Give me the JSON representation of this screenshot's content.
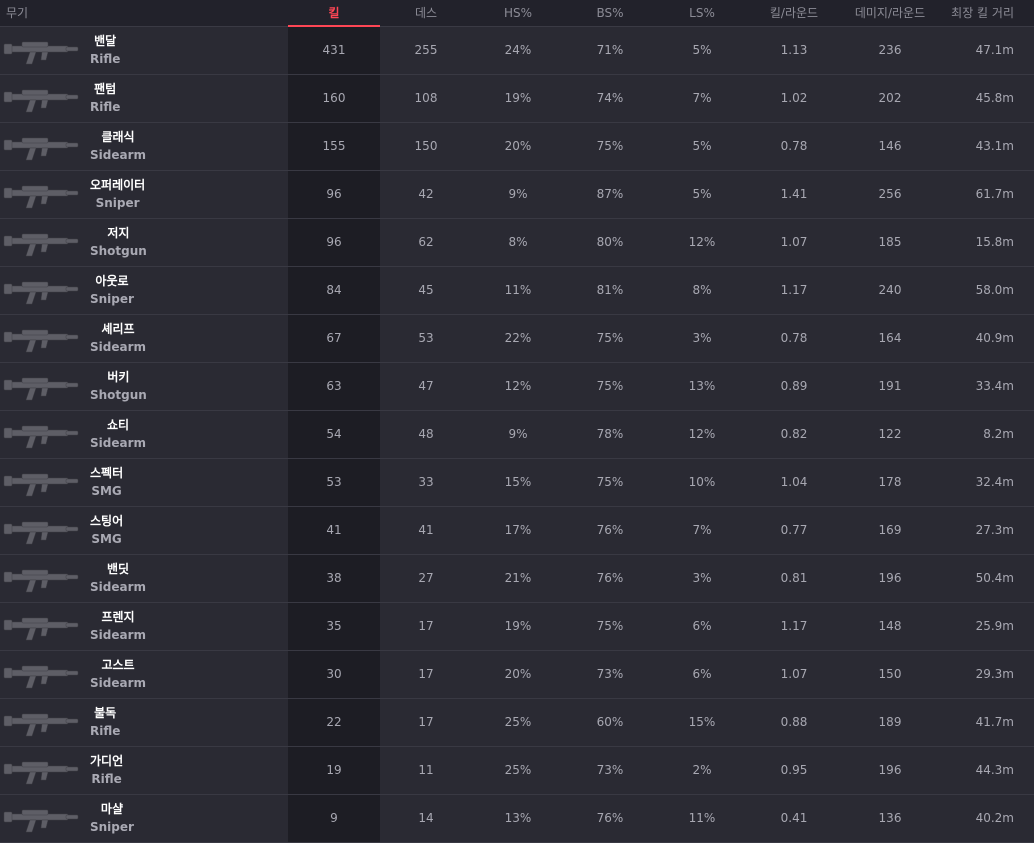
{
  "headers": {
    "weapon": "무기",
    "kills": "킬",
    "deaths": "데스",
    "hs": "HS%",
    "bs": "BS%",
    "ls": "LS%",
    "kills_round": "킬/라운드",
    "damage_round": "데미지/라운드",
    "longest_kill": "최장 킬 거리"
  },
  "rows": [
    {
      "name": "밴달",
      "type": "Rifle",
      "icon": "vandal-icon",
      "kills": "431",
      "deaths": "255",
      "hs": "24%",
      "bs": "71%",
      "ls": "5%",
      "kr": "1.13",
      "dr": "236",
      "dist": "47.1m"
    },
    {
      "name": "팬텀",
      "type": "Rifle",
      "icon": "phantom-icon",
      "kills": "160",
      "deaths": "108",
      "hs": "19%",
      "bs": "74%",
      "ls": "7%",
      "kr": "1.02",
      "dr": "202",
      "dist": "45.8m"
    },
    {
      "name": "클래식",
      "type": "Sidearm",
      "icon": "classic-icon",
      "kills": "155",
      "deaths": "150",
      "hs": "20%",
      "bs": "75%",
      "ls": "5%",
      "kr": "0.78",
      "dr": "146",
      "dist": "43.1m"
    },
    {
      "name": "오퍼레이터",
      "type": "Sniper",
      "icon": "operator-icon",
      "kills": "96",
      "deaths": "42",
      "hs": "9%",
      "bs": "87%",
      "ls": "5%",
      "kr": "1.41",
      "dr": "256",
      "dist": "61.7m"
    },
    {
      "name": "저지",
      "type": "Shotgun",
      "icon": "judge-icon",
      "kills": "96",
      "deaths": "62",
      "hs": "8%",
      "bs": "80%",
      "ls": "12%",
      "kr": "1.07",
      "dr": "185",
      "dist": "15.8m"
    },
    {
      "name": "아웃로",
      "type": "Sniper",
      "icon": "outlaw-icon",
      "kills": "84",
      "deaths": "45",
      "hs": "11%",
      "bs": "81%",
      "ls": "8%",
      "kr": "1.17",
      "dr": "240",
      "dist": "58.0m"
    },
    {
      "name": "셰리프",
      "type": "Sidearm",
      "icon": "sheriff-icon",
      "kills": "67",
      "deaths": "53",
      "hs": "22%",
      "bs": "75%",
      "ls": "3%",
      "kr": "0.78",
      "dr": "164",
      "dist": "40.9m"
    },
    {
      "name": "버키",
      "type": "Shotgun",
      "icon": "bucky-icon",
      "kills": "63",
      "deaths": "47",
      "hs": "12%",
      "bs": "75%",
      "ls": "13%",
      "kr": "0.89",
      "dr": "191",
      "dist": "33.4m"
    },
    {
      "name": "쇼티",
      "type": "Sidearm",
      "icon": "shorty-icon",
      "kills": "54",
      "deaths": "48",
      "hs": "9%",
      "bs": "78%",
      "ls": "12%",
      "kr": "0.82",
      "dr": "122",
      "dist": "8.2m"
    },
    {
      "name": "스펙터",
      "type": "SMG",
      "icon": "spectre-icon",
      "kills": "53",
      "deaths": "33",
      "hs": "15%",
      "bs": "75%",
      "ls": "10%",
      "kr": "1.04",
      "dr": "178",
      "dist": "32.4m"
    },
    {
      "name": "스팅어",
      "type": "SMG",
      "icon": "stinger-icon",
      "kills": "41",
      "deaths": "41",
      "hs": "17%",
      "bs": "76%",
      "ls": "7%",
      "kr": "0.77",
      "dr": "169",
      "dist": "27.3m"
    },
    {
      "name": "밴딧",
      "type": "Sidearm",
      "icon": "bandit-icon",
      "kills": "38",
      "deaths": "27",
      "hs": "21%",
      "bs": "76%",
      "ls": "3%",
      "kr": "0.81",
      "dr": "196",
      "dist": "50.4m"
    },
    {
      "name": "프렌지",
      "type": "Sidearm",
      "icon": "frenzy-icon",
      "kills": "35",
      "deaths": "17",
      "hs": "19%",
      "bs": "75%",
      "ls": "6%",
      "kr": "1.17",
      "dr": "148",
      "dist": "25.9m"
    },
    {
      "name": "고스트",
      "type": "Sidearm",
      "icon": "ghost-icon",
      "kills": "30",
      "deaths": "17",
      "hs": "20%",
      "bs": "73%",
      "ls": "6%",
      "kr": "1.07",
      "dr": "150",
      "dist": "29.3m"
    },
    {
      "name": "불독",
      "type": "Rifle",
      "icon": "bulldog-icon",
      "kills": "22",
      "deaths": "17",
      "hs": "25%",
      "bs": "60%",
      "ls": "15%",
      "kr": "0.88",
      "dr": "189",
      "dist": "41.7m"
    },
    {
      "name": "가디언",
      "type": "Rifle",
      "icon": "guardian-icon",
      "kills": "19",
      "deaths": "11",
      "hs": "25%",
      "bs": "73%",
      "ls": "2%",
      "kr": "0.95",
      "dr": "196",
      "dist": "44.3m"
    },
    {
      "name": "마샬",
      "type": "Sniper",
      "icon": "marshal-icon",
      "kills": "9",
      "deaths": "14",
      "hs": "13%",
      "bs": "76%",
      "ls": "11%",
      "kr": "0.41",
      "dr": "136",
      "dist": "40.2m"
    }
  ],
  "colors": {
    "accent": "#ff4655",
    "background": "#22222b",
    "row": "#2a2a33",
    "highlight_column": "#1d1d24"
  }
}
